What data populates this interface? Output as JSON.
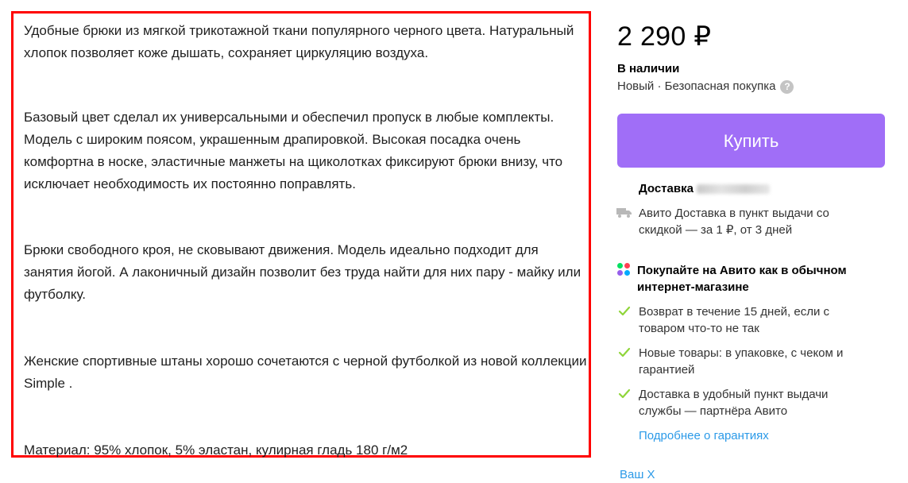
{
  "description": {
    "paragraphs": [
      "Удобные брюки из мягкой трикотажной ткани популярного черного цвета. Натуральный хлопок позволяет коже дышать, сохраняет циркуляцию воздуха.",
      "Базовый цвет сделал их универсальными и обеспечил пропуск в любые комплекты. Модель с широким поясом, украшенным драпировкой. Высокая посадка очень комфортна в носке, эластичные манжеты на щиколотках фиксируют брюки внизу, что исключает необходимость их постоянно поправлять.",
      "Брюки свободного кроя, не сковывают движения. Модель идеально подходит для занятия йогой. А лаконичный дизайн позволит без труда найти для них пару - майку или футболку.",
      "Женские спортивные штаны хорошо сочетаются с черной футболкой из новой коллекции Simple .",
      "Материал: 95% хлопок, 5% эластан, кулирная гладь 180 г/м2"
    ]
  },
  "offer": {
    "price": "2 290 ₽",
    "availability": "В наличии",
    "condition": "Новый · Безопасная покупка",
    "help_glyph": "?",
    "buy_label": "Купить"
  },
  "delivery": {
    "title": "Доставка",
    "text": "Авито Доставка в пункт выдачи со скидкой — за 1 ₽, от 3 дней"
  },
  "guarantees": {
    "title": "Покупайте на Авито как в обычном интернет-магазине",
    "items": [
      "Возврат в течение 15 дней, если с товаром что-то не так",
      "Новые товары: в упаковке, с чеком и гарантией",
      "Доставка в удобный пункт выдачи службы — партнёра Авито"
    ],
    "more_link": "Подробнее о гарантиях"
  },
  "cut_off_text": "Ваш Х",
  "icons": {
    "help": "help-icon",
    "delivery": "truck-icon",
    "avito": "avito-dots-icon",
    "check": "check-icon"
  },
  "colors": {
    "highlight_border": "#ff0000",
    "buy_button": "#a06ef7",
    "link": "#2b9ae8",
    "check": "#8fd53a"
  }
}
